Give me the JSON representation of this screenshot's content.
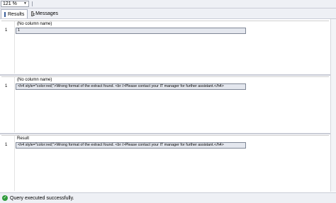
{
  "toolbar": {
    "zoom": "121 %"
  },
  "tabs": [
    {
      "label": "Results",
      "icon": "grid-icon",
      "active": true
    },
    {
      "label": "Messages",
      "icon": "messages-icon",
      "active": false
    }
  ],
  "result_sets": [
    {
      "column_header": "(No column name)",
      "rows": [
        {
          "num": "1",
          "value": "1"
        }
      ]
    },
    {
      "column_header": "(No column name)",
      "rows": [
        {
          "num": "1",
          "value": "<h4 style=\"color:red;\">Wrong format of the extract found. <br />Please contact your IT manager for further assistant.</h4>"
        }
      ]
    },
    {
      "column_header": "Result",
      "rows": [
        {
          "num": "1",
          "value": "<h4 style=\"color:red;\">Wrong format of the extract found. <br />Please contact your IT manager for further assistant.</h4>"
        }
      ]
    }
  ],
  "status": {
    "text": "Query executed successfully.",
    "icon": "check-circle-icon",
    "color": "#2e9a3a"
  }
}
